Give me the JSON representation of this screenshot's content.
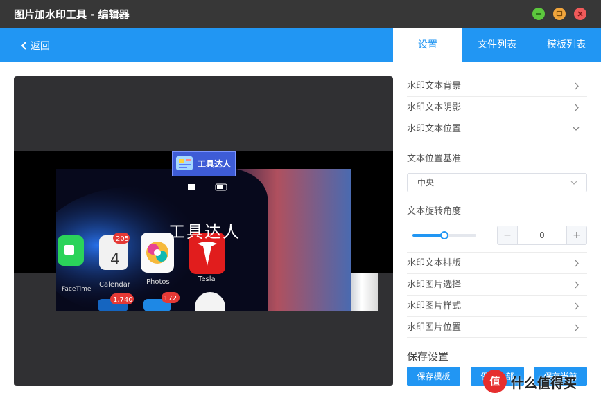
{
  "window": {
    "title": "图片加水印工具 - 编辑器"
  },
  "window_controls": {
    "minimize_color": "#5cc73d",
    "restore_color": "#f0a53c",
    "close_color": "#f05a5a"
  },
  "header": {
    "back_label": "返回",
    "accent": "#2196f3"
  },
  "tabs": [
    {
      "label": "设置",
      "active": true
    },
    {
      "label": "文件列表",
      "active": false
    },
    {
      "label": "模板列表",
      "active": false
    }
  ],
  "preview": {
    "logo_text": "工具达人",
    "watermark_text": "工具达人",
    "app_labels": {
      "calendar": "Calendar",
      "photos": "Photos",
      "tesla": "Tesla",
      "facetime": "FaceTime"
    },
    "badges": {
      "calendar": "205",
      "photos": "172",
      "mail": "1,740"
    },
    "calendar_day": "4"
  },
  "settings": {
    "sections_top": [
      "水印文本背景",
      "水印文本阴影",
      "水印文本位置"
    ],
    "position_base_label": "文本位置基准",
    "position_base_value": "中央",
    "rotation_label": "文本旋转角度",
    "rotation_fraction": 0.5,
    "rotation_value": "0",
    "minus": "−",
    "plus": "+",
    "sections_bottom": [
      "水印文本排版",
      "水印图片选择",
      "水印图片样式",
      "水印图片位置"
    ],
    "save_title": "保存设置",
    "buttons": [
      "保存模板",
      "保存全部",
      "保存当前"
    ]
  },
  "site_badge": {
    "mark": "值",
    "text": "什么值得买"
  }
}
